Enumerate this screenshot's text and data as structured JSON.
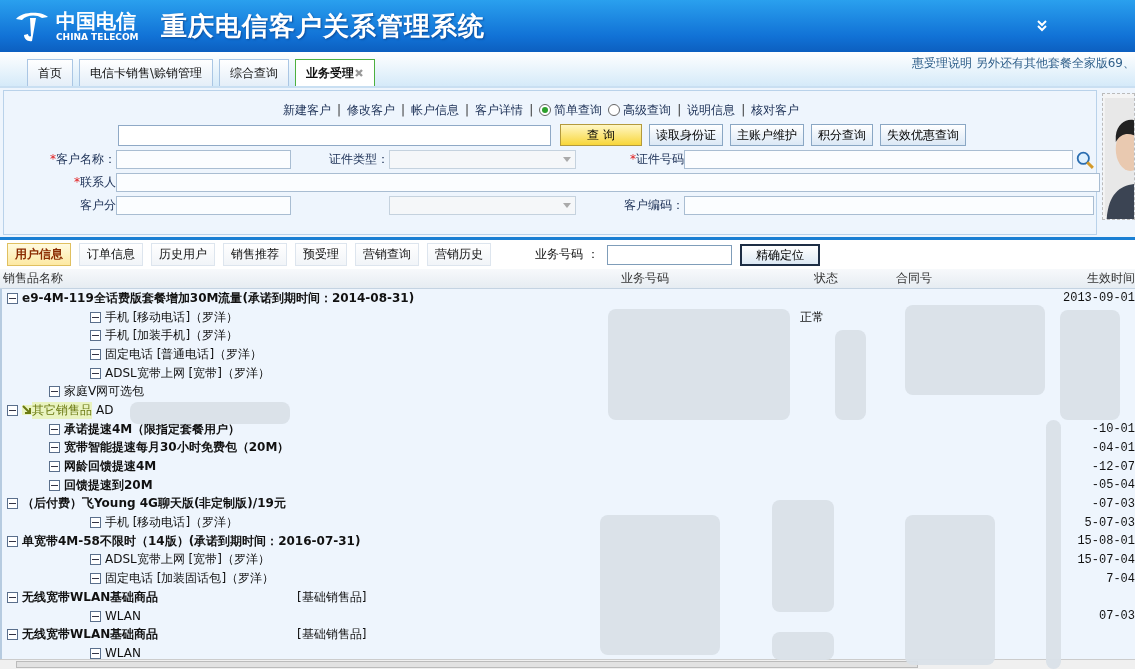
{
  "header": {
    "logo_cn": "中国电信",
    "logo_en": "CHINA TELECOM",
    "title": "重庆电信客户关系管理系统"
  },
  "tabs": [
    {
      "label": "首页",
      "selected": false,
      "closable": false
    },
    {
      "label": "电信卡销售\\赊销管理",
      "selected": false,
      "closable": false
    },
    {
      "label": "综合查询",
      "selected": false,
      "closable": false
    },
    {
      "label": "业务受理",
      "selected": true,
      "closable": true
    }
  ],
  "notice": "惠受理说明 另外还有其他套餐全家版69、",
  "query_links": [
    {
      "kind": "link",
      "label": "新建客户"
    },
    {
      "kind": "separator",
      "label": "|"
    },
    {
      "kind": "link",
      "label": "修改客户"
    },
    {
      "kind": "separator",
      "label": "|"
    },
    {
      "kind": "link",
      "label": "帐户信息"
    },
    {
      "kind": "separator",
      "label": "|"
    },
    {
      "kind": "link",
      "label": "客户详情"
    },
    {
      "kind": "separator",
      "label": "|"
    },
    {
      "kind": "radio",
      "label": "简单查询",
      "selected": true
    },
    {
      "kind": "radio",
      "label": "高级查询",
      "selected": false
    },
    {
      "kind": "separator",
      "label": "|"
    },
    {
      "kind": "link",
      "label": "说明信息"
    },
    {
      "kind": "separator",
      "label": "|"
    },
    {
      "kind": "link",
      "label": "核对客户"
    }
  ],
  "search_buttons": [
    {
      "label": "查 询",
      "primary": true
    },
    {
      "label": "读取身份证",
      "primary": false
    },
    {
      "label": "主账户维护",
      "primary": false
    },
    {
      "label": "积分查询",
      "primary": false
    },
    {
      "label": "失效优惠查询",
      "primary": false
    }
  ],
  "form_rows": [
    [
      {
        "label": "客户名称：",
        "required_mark": "*",
        "kind": "input"
      },
      {
        "label": "证件类型：",
        "kind": "select"
      },
      {
        "label": "证件号码",
        "required_mark": "*",
        "kind": "lookup"
      }
    ],
    [
      {
        "label": "联系人",
        "required_mark": "*",
        "kind": "input"
      }
    ],
    [
      {
        "label": "客户分",
        "kind": "input"
      },
      {
        "kind": "select"
      },
      {
        "label": "客户编码：",
        "kind": "input"
      }
    ]
  ],
  "subtabs": [
    {
      "label": "用户信息",
      "selected": true
    },
    {
      "label": "订单信息",
      "selected": false
    },
    {
      "label": "历史用户",
      "selected": false
    },
    {
      "label": "销售推荐",
      "selected": false
    },
    {
      "label": "预受理",
      "selected": false
    },
    {
      "label": "营销查询",
      "selected": false
    },
    {
      "label": "营销历史",
      "selected": false
    }
  ],
  "locate": {
    "label": "业务号码",
    "colon": "：",
    "button": "精确定位"
  },
  "table": {
    "columns": [
      "销售品名称",
      "业务号码",
      "状态",
      "合同号",
      "生效时间"
    ],
    "rows": [
      {
        "kind": "offer",
        "name": "e9-4M-119全话费版套餐增加30M流量(承诺到期时间：2014-08-31)",
        "expanded": true,
        "date": "2013-09-01",
        "children": [
          {
            "kind": "member",
            "name": "手机 [移动电话]（罗洋）",
            "expanded": true,
            "status": "正常"
          },
          {
            "kind": "member",
            "name": "手机 [加装手机]（罗洋）",
            "expanded": true
          },
          {
            "kind": "member",
            "name": "固定电话 [普通电话]（罗洋）",
            "expanded": true
          },
          {
            "kind": "member",
            "name": "ADSL宽带上网 [宽带]（罗洋）",
            "expanded": true
          },
          {
            "kind": "package",
            "name": "家庭V网可选包",
            "expanded": true
          }
        ]
      },
      {
        "kind": "group",
        "name": "其它销售品",
        "suffix": "AD",
        "expanded": true,
        "children": [
          {
            "kind": "addon",
            "name": "承诺提速4M（限指定套餐用户）",
            "expanded": true,
            "date": "-10-01"
          },
          {
            "kind": "addon",
            "name": "宽带智能提速每月30小时免费包（20M）",
            "expanded": true,
            "date": "-04-01"
          },
          {
            "kind": "addon",
            "name": "网龄回馈提速4M",
            "expanded": true,
            "date": "-12-07"
          },
          {
            "kind": "addon",
            "name": "回馈提速到20M",
            "expanded": true,
            "date": "-05-04"
          }
        ]
      },
      {
        "kind": "offer",
        "name": "（后付费）飞Young 4G聊天版(非定制版)/19元",
        "expanded": true,
        "date": "-07-03",
        "children": [
          {
            "kind": "member",
            "name": "手机 [移动电话]（罗洋）",
            "expanded": true,
            "date": "5-07-03"
          }
        ]
      },
      {
        "kind": "offer",
        "name": "单宽带4M-58不限时（14版）(承诺到期时间：2016-07-31)",
        "expanded": true,
        "date": "15-08-01",
        "children": [
          {
            "kind": "member",
            "name": "ADSL宽带上网 [宽带]（罗洋）",
            "expanded": true,
            "date": "15-07-04"
          },
          {
            "kind": "member",
            "name": "固定电话 [加装固话包]（罗洋）",
            "expanded": true,
            "date": "7-04"
          }
        ]
      },
      {
        "kind": "offer",
        "name": "无线宽带WLAN基础商品",
        "tag": "[基础销售品]",
        "expanded": true,
        "children": [
          {
            "kind": "member",
            "name": "WLAN",
            "expanded": true,
            "date": "07-03"
          }
        ]
      },
      {
        "kind": "offer",
        "name": "无线宽带WLAN基础商品",
        "tag": "[基础销售品]",
        "expanded": true,
        "children": [
          {
            "kind": "member",
            "name": "WLAN",
            "expanded": true
          }
        ]
      }
    ]
  }
}
